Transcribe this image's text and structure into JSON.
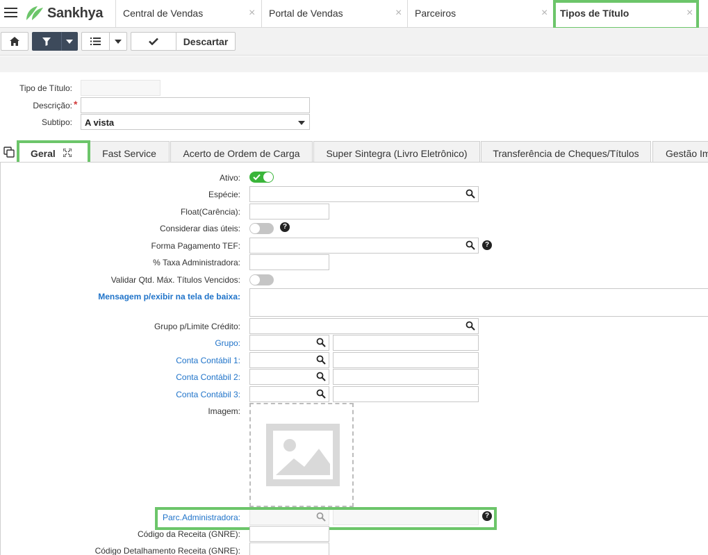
{
  "app": {
    "brand": "Sankhya",
    "brand_color": "#6cc56a"
  },
  "tabs": [
    {
      "label": "Central de Vendas"
    },
    {
      "label": "Portal de Vendas"
    },
    {
      "label": "Parceiros"
    },
    {
      "label": "Tipos de Título"
    }
  ],
  "close_glyph": "×",
  "toolbar": {
    "discard_label": "Descartar"
  },
  "header_form": {
    "tipo_label": "Tipo de Título:",
    "tipo_value": "",
    "descricao_label": "Descrição:",
    "descricao_required": "*",
    "descricao_value": "",
    "subtipo_label": "Subtipo:",
    "subtipo_value": "A vista"
  },
  "form_tabs": [
    {
      "label": "Geral"
    },
    {
      "label": "Fast Service"
    },
    {
      "label": "Acerto de Ordem de Carga"
    },
    {
      "label": "Super Sintegra (Livro Eletrônico)"
    },
    {
      "label": "Transferência de Cheques/Títulos"
    },
    {
      "label": "Gestão Im"
    }
  ],
  "general": {
    "ativo_label": "Ativo:",
    "ativo_on": true,
    "especie_label": "Espécie:",
    "float_label": "Float(Carência):",
    "dias_uteis_label": "Considerar dias úteis:",
    "forma_pagamento_label": "Forma Pagamento TEF:",
    "taxa_label": "% Taxa Administradora:",
    "validar_label": "Validar Qtd. Máx. Títulos Vencidos:",
    "mensagem_label": "Mensagem p/exibir na tela de baixa:",
    "grupo_limite_label": "Grupo p/Limite Crédito:",
    "grupo_label": "Grupo:",
    "conta1_label": "Conta Contábil 1:",
    "conta2_label": "Conta Contábil 2:",
    "conta3_label": "Conta Contábil 3:",
    "imagem_label": "Imagem:",
    "parc_label": "Parc.Administradora:",
    "codigo_receita_label": "Código da Receita (GNRE):",
    "codigo_detalhamento_label": "Código Detalhamento Receita (GNRE):",
    "help_glyph": "?"
  }
}
